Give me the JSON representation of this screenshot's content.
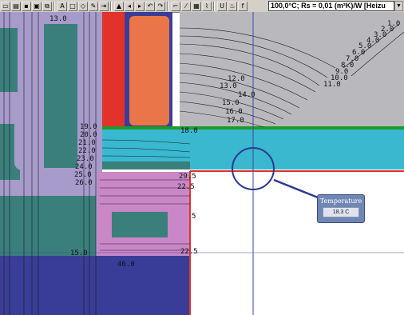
{
  "toolbar": {
    "buttons": [
      {
        "name": "new-file-icon",
        "glyph": "▭"
      },
      {
        "name": "open-folder-icon",
        "glyph": "▤"
      },
      {
        "name": "save-icon",
        "glyph": "▪"
      },
      {
        "name": "print-icon",
        "glyph": "▣"
      },
      {
        "name": "copy-icon",
        "glyph": "⧉"
      },
      {
        "name": "text-tool-icon",
        "glyph": "A"
      },
      {
        "name": "rectangle-tool-icon",
        "glyph": "□"
      },
      {
        "name": "polygon-tool-icon",
        "glyph": "◇"
      },
      {
        "name": "pencil-icon",
        "glyph": "✎"
      },
      {
        "name": "move-icon",
        "glyph": "⇥"
      },
      {
        "name": "shape-icon",
        "glyph": "▲"
      },
      {
        "name": "node-left-icon",
        "glyph": "◂"
      },
      {
        "name": "node-right-icon",
        "glyph": "▸"
      },
      {
        "name": "undo-icon",
        "glyph": "↶"
      },
      {
        "name": "redo-icon",
        "glyph": "↷"
      },
      {
        "name": "measure-icon",
        "glyph": "⌐"
      },
      {
        "name": "pipette-icon",
        "glyph": "⁄"
      },
      {
        "name": "hatch-icon",
        "glyph": "▦"
      },
      {
        "name": "boundary-icon",
        "glyph": "⌇"
      },
      {
        "name": "u-value-icon",
        "glyph": "U"
      },
      {
        "name": "isotherm-icon",
        "glyph": "♨"
      },
      {
        "name": "temperature-factor-icon",
        "glyph": "f"
      }
    ],
    "boundary_status": "100,0°C; Rs = 0,01 (m²K)/W  [Heizu",
    "dropdown_glyph": "▼"
  },
  "tooltip": {
    "title": "Temperature",
    "value": "18.3 C"
  },
  "isotherms": [
    {
      "text": "13.0"
    },
    {
      "text": "12.0"
    },
    {
      "text": "13.0"
    },
    {
      "text": "14.0"
    },
    {
      "text": "15.0"
    },
    {
      "text": "16.0"
    },
    {
      "text": "17.0"
    },
    {
      "text": "18.0"
    },
    {
      "text": "19.0"
    },
    {
      "text": "20.0"
    },
    {
      "text": "21.0"
    },
    {
      "text": "22.0"
    },
    {
      "text": "23.0"
    },
    {
      "text": "24.0"
    },
    {
      "text": "25.0"
    },
    {
      "text": "26.0"
    },
    {
      "text": "22.5"
    },
    {
      "text": "5"
    },
    {
      "text": "15.0"
    },
    {
      "text": "46.0"
    },
    {
      "text": "11.0"
    },
    {
      "text": "10.0"
    },
    {
      "text": "9.0"
    },
    {
      "text": "8.0"
    },
    {
      "text": "7.0"
    },
    {
      "text": "6.0"
    },
    {
      "text": "5.0"
    },
    {
      "text": "4.0"
    },
    {
      "text": "3.0"
    },
    {
      "text": "2.0"
    },
    {
      "text": "1.0"
    },
    {
      "text": "29.5"
    },
    {
      "text": "22.5"
    }
  ],
  "colors": {
    "gray_insulation": "#b9b9bd",
    "lavender_frame": "#a79bcc",
    "teal_profile": "#3a7f7c",
    "cyan_glazing": "#39b8d0",
    "orange_core": "#ea7548",
    "red_layer": "#e2322a",
    "green_line": "#1f9a2a",
    "navy_floor": "#3a3d97",
    "pink_block": "#c987c8",
    "crosshair": "#3b4aa0"
  }
}
